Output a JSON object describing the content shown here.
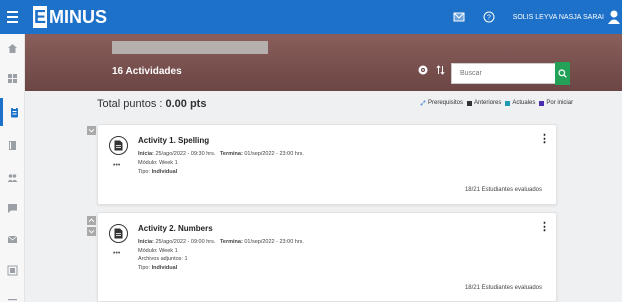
{
  "topbar": {
    "logo_letter": "E",
    "logo_text": "MINUS",
    "user_name": "SOLIS LEYVA NASJA SARAI",
    "icons": [
      "menu-icon",
      "mail-icon",
      "help-icon",
      "user-icon"
    ],
    "color": "#1d71c9"
  },
  "sidebar": {
    "items": [
      "home-icon",
      "dashboard-icon",
      "activities-icon",
      "book-icon",
      "people-icon",
      "chat-icon",
      "mail-icon",
      "gradebook-icon",
      "list-icon"
    ],
    "active_index": 2
  },
  "banner": {
    "title": "16 Actividades",
    "search_placeholder": "Buscar",
    "color": "#7a5351"
  },
  "summary": {
    "total_points": "Total puntos : ",
    "total_value": "0.00 pts"
  },
  "legend": {
    "prereq": "Prerequisitos",
    "items": [
      {
        "label": "Anteriores",
        "color": "#333333"
      },
      {
        "label": "Actuales",
        "color": "#1e9bb3"
      },
      {
        "label": "Por iniciar",
        "color": "#4b2db0"
      }
    ]
  },
  "activities": [
    {
      "title": "Activity 1. Spelling",
      "start_label": "Inicia:",
      "start": "25/ago/2022 - 09:30 hrs.",
      "end_label": "Termina:",
      "end": "01/sep/2022 - 23:00 hrs.",
      "module": "Módulo: Week 1",
      "attachments": "",
      "type_label": "Tipo:",
      "type": "Individual",
      "evaluated": "18/21 Estudiantes evaluados",
      "dots": "•••",
      "menu": "⋮"
    },
    {
      "title": "Activity 2. Numbers",
      "start_label": "Inicia:",
      "start": "25/ago/2022 - 09:00 hrs.",
      "end_label": "Termina:",
      "end": "01/sep/2022 - 23:00 hrs.",
      "module": "Módulo: Week 1",
      "attachments": "Archivos adjuntos: 1",
      "type_label": "Tipo:",
      "type": "Individual",
      "evaluated": "18/21 Estudiantes evaluados",
      "dots": "•••",
      "menu": "⋮"
    }
  ]
}
